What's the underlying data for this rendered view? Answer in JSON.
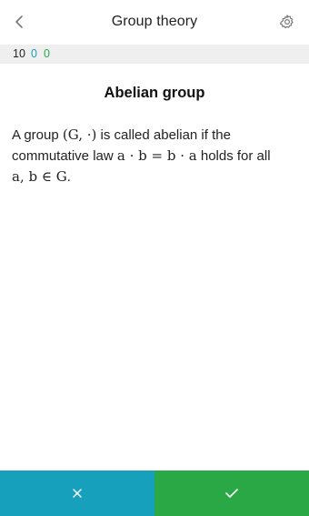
{
  "header": {
    "title": "Group theory",
    "back_icon": "chevron-left-icon",
    "settings_icon": "gear-icon"
  },
  "stats": {
    "total": "10",
    "blue": "0",
    "green": "0"
  },
  "card": {
    "title": "Abelian group",
    "text_1": "A group ",
    "math_1": "(G, ·)",
    "text_2": " is called abelian if the commutative law ",
    "math_2": "a · b = b · a",
    "text_3": " holds for all ",
    "math_3": "a, b ∈ G",
    "text_4": "."
  },
  "buttons": {
    "wrong_icon": "close-icon",
    "right_icon": "check-icon"
  },
  "colors": {
    "blue": "#1aa0bd",
    "green": "#2aa84a",
    "stats_bg": "#efefef"
  }
}
